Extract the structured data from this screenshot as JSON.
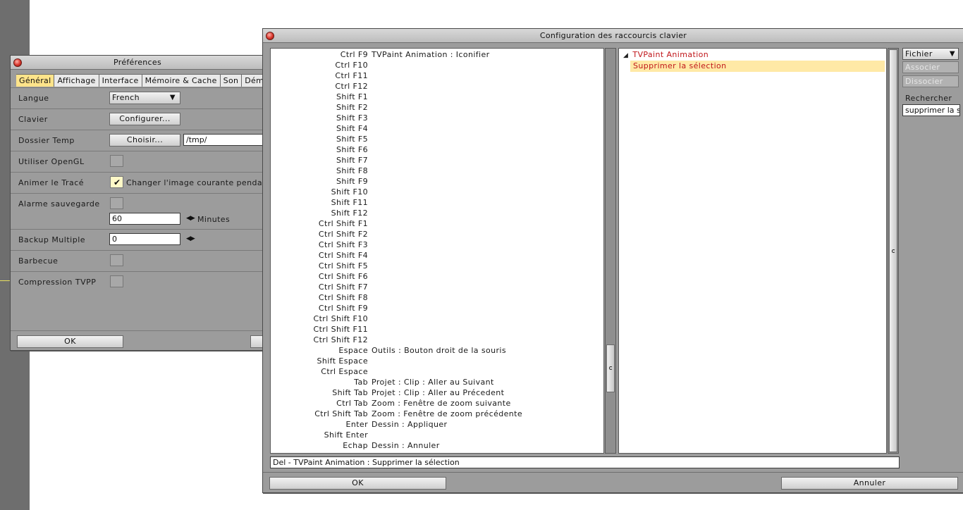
{
  "preferences": {
    "title": "Préférences",
    "tabs": [
      "Général",
      "Affichage",
      "Interface",
      "Mémoire & Cache",
      "Son",
      "Dém"
    ],
    "langue_label": "Langue",
    "langue_value": "French",
    "clavier_label": "Clavier",
    "clavier_button": "Configurer...",
    "dossier_label": "Dossier Temp",
    "dossier_button": "Choisir...",
    "dossier_value": "/tmp/",
    "opengl_label": "Utiliser OpenGL",
    "animer_label": "Animer le Tracé",
    "animer_text": "Changer l'image courante pendant",
    "alarme_label": "Alarme sauvegarde",
    "alarme_value": "60",
    "alarme_unit": "Minutes",
    "backup_label": "Backup Multiple",
    "backup_value": "0",
    "barbecue_label": "Barbecue",
    "compression_label": "Compression TVPP",
    "ok_label": "OK"
  },
  "shortcuts": {
    "title": "Configuration des raccourcis clavier",
    "rows": [
      {
        "key": "Ctrl F9",
        "action": "TVPaint Animation : Iconifier"
      },
      {
        "key": "Ctrl F10",
        "action": ""
      },
      {
        "key": "Ctrl F11",
        "action": ""
      },
      {
        "key": "Ctrl F12",
        "action": ""
      },
      {
        "key": "Shift F1",
        "action": ""
      },
      {
        "key": "Shift F2",
        "action": ""
      },
      {
        "key": "Shift F3",
        "action": ""
      },
      {
        "key": "Shift F4",
        "action": ""
      },
      {
        "key": "Shift F5",
        "action": ""
      },
      {
        "key": "Shift F6",
        "action": ""
      },
      {
        "key": "Shift F7",
        "action": ""
      },
      {
        "key": "Shift F8",
        "action": ""
      },
      {
        "key": "Shift F9",
        "action": ""
      },
      {
        "key": "Shift F10",
        "action": ""
      },
      {
        "key": "Shift F11",
        "action": ""
      },
      {
        "key": "Shift F12",
        "action": ""
      },
      {
        "key": "Ctrl Shift F1",
        "action": ""
      },
      {
        "key": "Ctrl Shift F2",
        "action": ""
      },
      {
        "key": "Ctrl Shift F3",
        "action": ""
      },
      {
        "key": "Ctrl Shift F4",
        "action": ""
      },
      {
        "key": "Ctrl Shift F5",
        "action": ""
      },
      {
        "key": "Ctrl Shift F6",
        "action": ""
      },
      {
        "key": "Ctrl Shift F7",
        "action": ""
      },
      {
        "key": "Ctrl Shift F8",
        "action": ""
      },
      {
        "key": "Ctrl Shift F9",
        "action": ""
      },
      {
        "key": "Ctrl Shift F10",
        "action": ""
      },
      {
        "key": "Ctrl Shift F11",
        "action": ""
      },
      {
        "key": "Ctrl Shift F12",
        "action": ""
      },
      {
        "key": "Espace",
        "action": "Outils : Bouton droit de la souris"
      },
      {
        "key": "Shift Espace",
        "action": ""
      },
      {
        "key": "Ctrl Espace",
        "action": ""
      },
      {
        "key": "Tab",
        "action": "Projet : Clip : Aller au Suivant"
      },
      {
        "key": "Shift Tab",
        "action": "Projet : Clip : Aller au Précedent"
      },
      {
        "key": "Ctrl Tab",
        "action": "Zoom : Fenêtre de zoom suivante"
      },
      {
        "key": "Ctrl Shift Tab",
        "action": "Zoom : Fenêtre de zoom précédente"
      },
      {
        "key": "Enter",
        "action": "Dessin : Appliquer"
      },
      {
        "key": "Shift Enter",
        "action": ""
      },
      {
        "key": "Echap",
        "action": "Dessin : Annuler"
      }
    ],
    "tree_root": "TVPaint Animation",
    "tree_selected": "Supprimer la sélection",
    "fichier_label": "Fichier",
    "associer_label": "Associer",
    "dissocier_label": "Dissocier",
    "rechercher_label": "Rechercher",
    "rechercher_value": "supprimer la s",
    "status_text": "Del - TVPaint Animation : Supprimer la sélection",
    "ok_label": "OK",
    "annuler_label": "Annuler"
  }
}
